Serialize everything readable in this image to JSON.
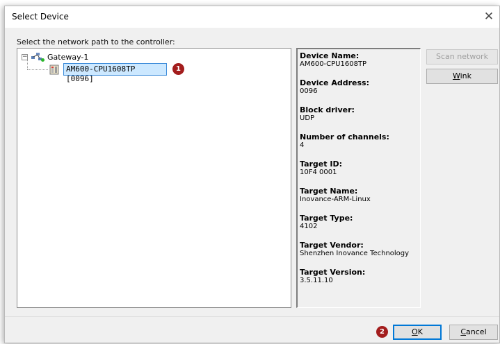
{
  "dialog": {
    "title": "Select Device",
    "close_glyph": "✕"
  },
  "prompt": "Select the network path to the controller:",
  "tree": {
    "gateway": {
      "label": "Gateway-1",
      "expander": "−",
      "icon": "network-gateway-icon"
    },
    "device": {
      "label": "AM600-CPU1608TP [0096]",
      "icon": "controller-device-icon"
    }
  },
  "badges": {
    "first": "1",
    "second": "2"
  },
  "device_info": [
    {
      "name": "Device Name:",
      "value": "AM600-CPU1608TP"
    },
    {
      "name": "Device Address:",
      "value": "0096"
    },
    {
      "name": "Block driver:",
      "value": "UDP"
    },
    {
      "name": "Number of channels:",
      "value": "4"
    },
    {
      "name": "Target ID:",
      "value": "10F4 0001"
    },
    {
      "name": "Target Name:",
      "value": "Inovance-ARM-Linux"
    },
    {
      "name": "Target Type:",
      "value": "4102"
    },
    {
      "name": "Target Vendor:",
      "value": "Shenzhen Inovance Technology"
    },
    {
      "name": "Target Version:",
      "value": "3.5.11.10"
    }
  ],
  "buttons": {
    "scan_network": "Scan network",
    "wink_prefix": "W",
    "wink_rest": "ink",
    "ok_prefix": "O",
    "ok_rest": "K",
    "cancel_prefix": "C",
    "cancel_rest": "ancel"
  },
  "colors": {
    "selection_bg": "#cce8ff",
    "selection_border": "#3c8bd9",
    "badge": "#a31d1d",
    "primary_border": "#0078d7"
  }
}
